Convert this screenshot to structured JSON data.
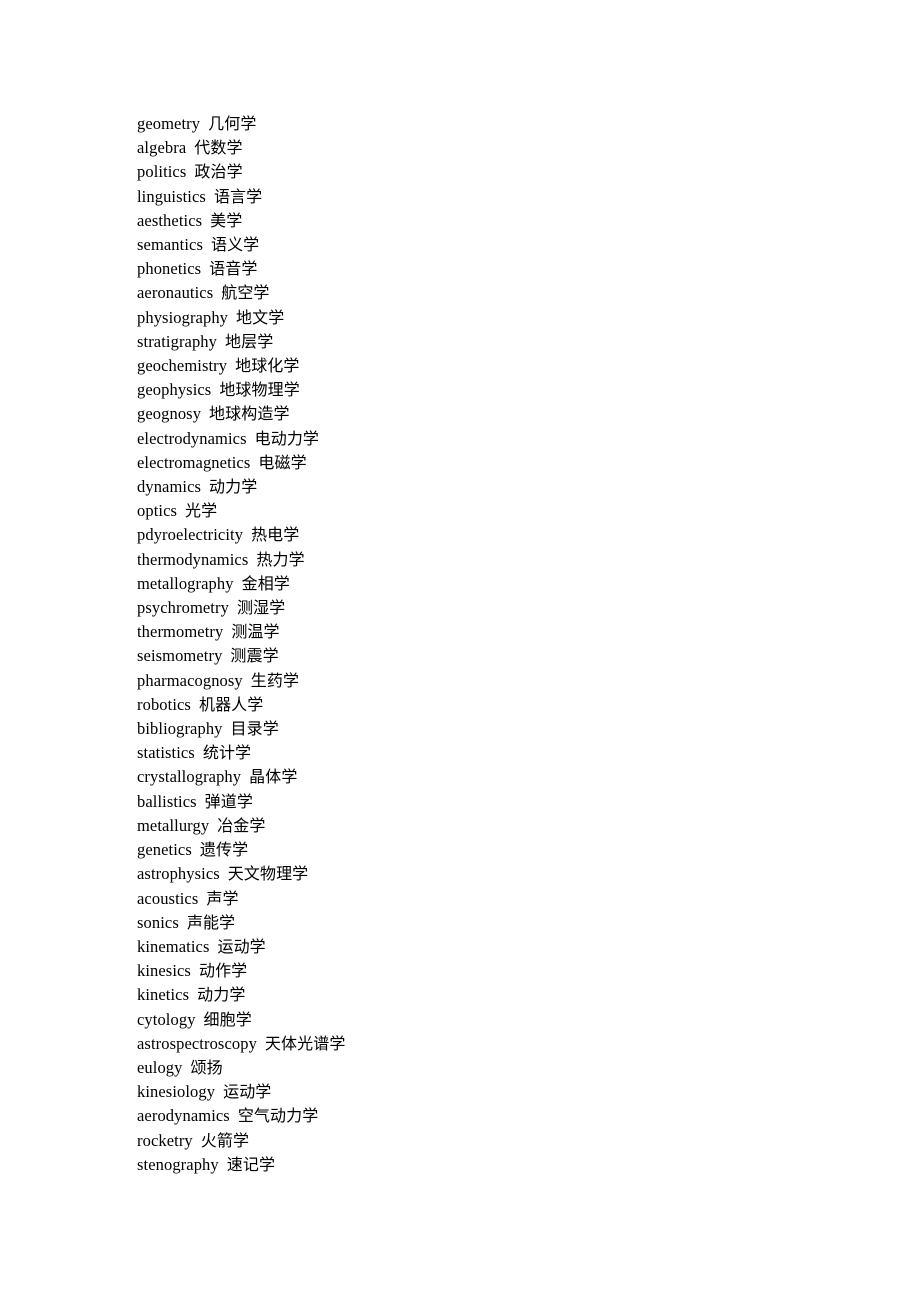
{
  "document": {
    "type": "bilingual-glossary",
    "entries": [
      {
        "en": "geometry",
        "zh": "几何学"
      },
      {
        "en": "algebra",
        "zh": "代数学"
      },
      {
        "en": "politics",
        "zh": "政治学"
      },
      {
        "en": "linguistics",
        "zh": "语言学"
      },
      {
        "en": "aesthetics",
        "zh": "美学"
      },
      {
        "en": "semantics",
        "zh": "语义学"
      },
      {
        "en": "phonetics",
        "zh": "语音学"
      },
      {
        "en": "aeronautics",
        "zh": "航空学"
      },
      {
        "en": "physiography",
        "zh": "地文学"
      },
      {
        "en": "stratigraphy",
        "zh": "地层学"
      },
      {
        "en": "geochemistry",
        "zh": "地球化学"
      },
      {
        "en": "geophysics",
        "zh": "地球物理学"
      },
      {
        "en": "geognosy",
        "zh": "地球构造学"
      },
      {
        "en": "electrodynamics",
        "zh": "电动力学"
      },
      {
        "en": "electromagnetics",
        "zh": "电磁学"
      },
      {
        "en": "dynamics",
        "zh": "动力学"
      },
      {
        "en": "optics",
        "zh": "光学"
      },
      {
        "en": "pdyroelectricity",
        "zh": "热电学"
      },
      {
        "en": "thermodynamics",
        "zh": "热力学"
      },
      {
        "en": "metallography",
        "zh": "金相学"
      },
      {
        "en": "psychrometry",
        "zh": "测湿学"
      },
      {
        "en": "thermometry",
        "zh": "测温学"
      },
      {
        "en": "seismometry",
        "zh": "测震学"
      },
      {
        "en": "pharmacognosy",
        "zh": "生药学"
      },
      {
        "en": "robotics",
        "zh": "机器人学"
      },
      {
        "en": "bibliography",
        "zh": "目录学"
      },
      {
        "en": "statistics",
        "zh": "统计学"
      },
      {
        "en": "crystallography",
        "zh": "晶体学"
      },
      {
        "en": "ballistics",
        "zh": "弹道学"
      },
      {
        "en": "metallurgy",
        "zh": "冶金学"
      },
      {
        "en": "genetics",
        "zh": "遗传学"
      },
      {
        "en": "astrophysics",
        "zh": "天文物理学"
      },
      {
        "en": "acoustics",
        "zh": "声学"
      },
      {
        "en": "sonics",
        "zh": "声能学"
      },
      {
        "en": "kinematics",
        "zh": "运动学"
      },
      {
        "en": "kinesics",
        "zh": "动作学"
      },
      {
        "en": "kinetics",
        "zh": "动力学"
      },
      {
        "en": "cytology",
        "zh": "细胞学"
      },
      {
        "en": "astrospectroscopy",
        "zh": "天体光谱学"
      },
      {
        "en": "eulogy",
        "zh": "颂扬"
      },
      {
        "en": "kinesiology",
        "zh": "运动学"
      },
      {
        "en": "aerodynamics",
        "zh": "空气动力学"
      },
      {
        "en": "rocketry",
        "zh": "火箭学"
      },
      {
        "en": "stenography",
        "zh": "速记学"
      }
    ]
  }
}
